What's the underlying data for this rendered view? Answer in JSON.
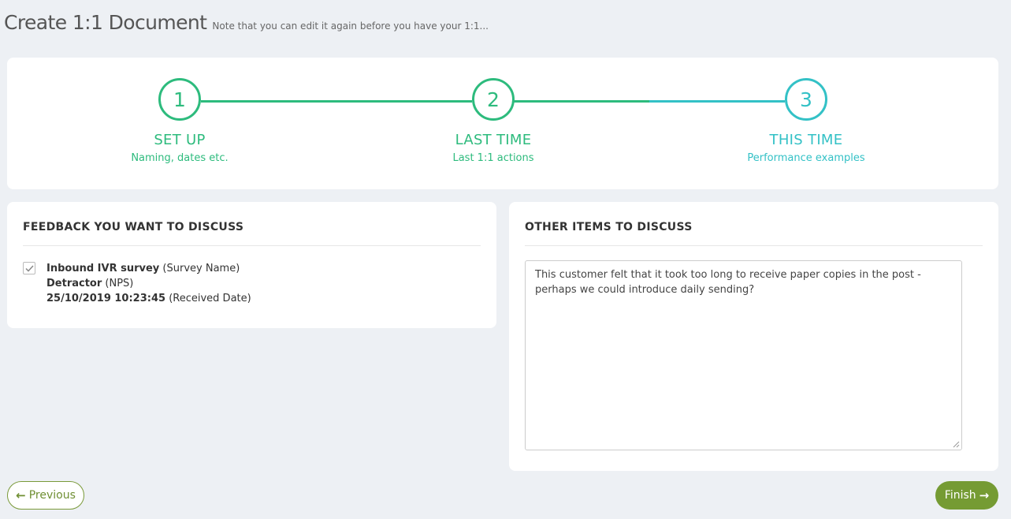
{
  "header": {
    "title": "Create 1:1 Document",
    "subtitle": "Note that you can edit it again before you have your 1:1..."
  },
  "colors": {
    "green": "#2dbb7d",
    "teal": "#33c1c6",
    "olive_button": "#759b33",
    "background": "#edf0f4"
  },
  "stepper": {
    "steps": [
      {
        "number": "1",
        "label": "SET UP",
        "sub": "Naming, dates etc."
      },
      {
        "number": "2",
        "label": "LAST TIME",
        "sub": "Last 1:1 actions"
      },
      {
        "number": "3",
        "label": "THIS TIME",
        "sub": "Performance examples"
      }
    ]
  },
  "feedback": {
    "heading": "FEEDBACK YOU WANT TO DISCUSS",
    "item": {
      "checked": true,
      "survey_name": "Inbound IVR survey",
      "survey_name_label": "(Survey Name)",
      "nps": "Detractor",
      "nps_label": "(NPS)",
      "received_date": "25/10/2019 10:23:45",
      "received_date_label": "(Received Date)"
    }
  },
  "other": {
    "heading": "OTHER ITEMS TO DISCUSS",
    "text": "This customer felt that it took too long to receive paper copies in the post - perhaps we could introduce daily sending?"
  },
  "footer": {
    "previous_label": "Previous",
    "finish_label": "Finish"
  }
}
